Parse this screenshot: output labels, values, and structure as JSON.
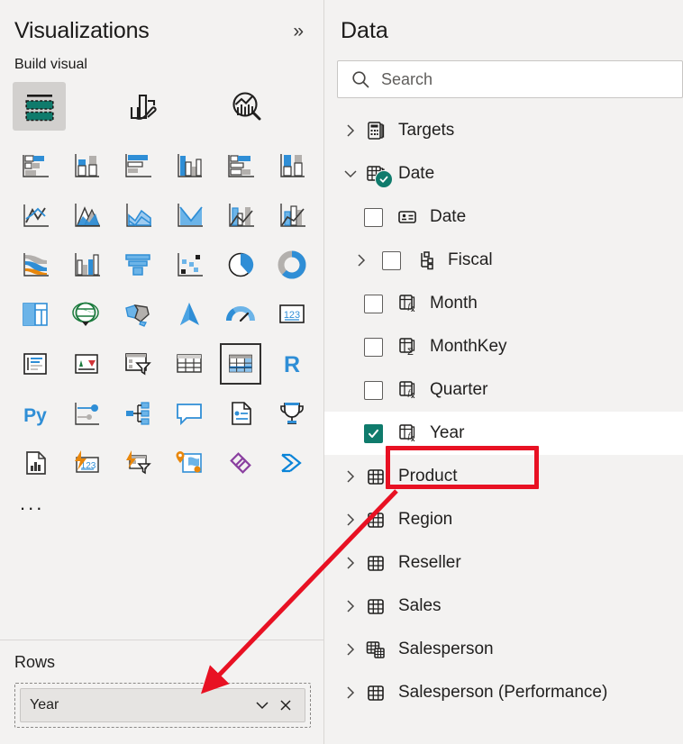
{
  "visualizations": {
    "title": "Visualizations",
    "collapse_icon": "double-chevron-right-icon",
    "build_visual_label": "Build visual",
    "tabs": [
      {
        "label": "Build visual",
        "icon": "build-visual-icon",
        "selected": true
      },
      {
        "label": "Format visual",
        "icon": "paintbrush-icon",
        "selected": false
      },
      {
        "label": "Analytics",
        "icon": "analytics-magnifier-icon",
        "selected": false
      }
    ],
    "gallery": [
      {
        "name": "stacked-bar-chart",
        "selected": false
      },
      {
        "name": "stacked-column-chart",
        "selected": false
      },
      {
        "name": "clustered-bar-chart",
        "selected": false
      },
      {
        "name": "clustered-column-chart",
        "selected": false
      },
      {
        "name": "100-stacked-bar-chart",
        "selected": false
      },
      {
        "name": "100-stacked-column-chart",
        "selected": false
      },
      {
        "name": "line-chart",
        "selected": false
      },
      {
        "name": "area-chart",
        "selected": false
      },
      {
        "name": "stacked-area-chart",
        "selected": false
      },
      {
        "name": "line-and-stacked-column-chart",
        "selected": false
      },
      {
        "name": "line-and-clustered-column-chart",
        "selected": false
      },
      {
        "name": "ribbon-chart",
        "selected": false
      },
      {
        "name": "waterfall-chart",
        "selected": false
      },
      {
        "name": "funnel-chart",
        "selected": false
      },
      {
        "name": "scatter-chart",
        "selected": false
      },
      {
        "name": "pie-chart",
        "selected": false
      },
      {
        "name": "donut-chart",
        "selected": false
      },
      {
        "name": "treemap",
        "selected": false
      },
      {
        "name": "map",
        "selected": false
      },
      {
        "name": "filled-map",
        "selected": false
      },
      {
        "name": "azure-map",
        "selected": false
      },
      {
        "name": "gauge-chart",
        "selected": false
      },
      {
        "name": "card",
        "selected": false
      },
      {
        "name": "multi-row-card",
        "selected": false
      },
      {
        "name": "kpi",
        "selected": false
      },
      {
        "name": "slicer",
        "selected": false
      },
      {
        "name": "table",
        "selected": false
      },
      {
        "name": "matrix",
        "selected": true
      },
      {
        "name": "r-script-visual",
        "selected": false
      },
      {
        "name": "python-visual",
        "selected": false
      },
      {
        "name": "key-influencers",
        "selected": false
      },
      {
        "name": "decomposition-tree",
        "selected": false
      },
      {
        "name": "qna-visual",
        "selected": false
      },
      {
        "name": "smart-narrative",
        "selected": false
      },
      {
        "name": "metrics-scorecard",
        "selected": false
      },
      {
        "name": "paginated-report",
        "selected": false
      },
      {
        "name": "power-apps-visual",
        "selected": false
      },
      {
        "name": "power-automate-visual",
        "selected": false
      },
      {
        "name": "arcgis-map",
        "selected": false
      },
      {
        "name": "powerbi-visual-purple",
        "selected": false
      },
      {
        "name": "powerbi-visual-blue",
        "selected": false
      }
    ],
    "more_options_label": "...",
    "wells": {
      "rows": {
        "title": "Rows",
        "fields": [
          {
            "label": "Year",
            "dropdown_icon": "chevron-down-icon",
            "remove_icon": "close-icon"
          }
        ]
      }
    }
  },
  "data_pane": {
    "title": "Data",
    "search": {
      "placeholder": "Search",
      "icon": "search-icon",
      "value": ""
    },
    "tree": [
      {
        "label": "Targets",
        "icon": "measure-table-icon",
        "expanded": false,
        "level": 0,
        "has_checkbox": false,
        "badge": false
      },
      {
        "label": "Date",
        "icon": "date-table-icon",
        "expanded": true,
        "level": 0,
        "has_checkbox": false,
        "badge": true
      },
      {
        "label": "Date",
        "icon": "date-field-icon",
        "level": 1,
        "has_checkbox": true,
        "checked": false,
        "expandable": false
      },
      {
        "label": "Fiscal",
        "icon": "hierarchy-icon",
        "level": 1,
        "has_checkbox": true,
        "checked": false,
        "expandable": true
      },
      {
        "label": "Month",
        "icon": "calculated-column-icon",
        "level": 1,
        "has_checkbox": true,
        "checked": false,
        "expandable": false
      },
      {
        "label": "MonthKey",
        "icon": "summarized-column-icon",
        "level": 1,
        "has_checkbox": true,
        "checked": false,
        "expandable": false
      },
      {
        "label": "Quarter",
        "icon": "calculated-column-icon",
        "level": 1,
        "has_checkbox": true,
        "checked": false,
        "expandable": false
      },
      {
        "label": "Year",
        "icon": "calculated-column-icon",
        "level": 1,
        "has_checkbox": true,
        "checked": true,
        "expandable": false,
        "highlighted": true
      },
      {
        "label": "Product",
        "icon": "table-icon",
        "expanded": false,
        "level": 0,
        "has_checkbox": false,
        "badge": false
      },
      {
        "label": "Region",
        "icon": "table-icon",
        "expanded": false,
        "level": 0,
        "has_checkbox": false,
        "badge": false
      },
      {
        "label": "Reseller",
        "icon": "table-icon",
        "expanded": false,
        "level": 0,
        "has_checkbox": false,
        "badge": false
      },
      {
        "label": "Sales",
        "icon": "table-icon",
        "expanded": false,
        "level": 0,
        "has_checkbox": false,
        "badge": false
      },
      {
        "label": "Salesperson",
        "icon": "related-table-icon",
        "expanded": false,
        "level": 0,
        "has_checkbox": false,
        "badge": false
      },
      {
        "label": "Salesperson (Performance)",
        "icon": "table-icon",
        "expanded": false,
        "level": 0,
        "has_checkbox": false,
        "badge": false
      }
    ]
  },
  "annotation": {
    "color": "#e81123",
    "highlight_target": "Year",
    "arrow_from": "Year",
    "arrow_to": "Rows well Year field"
  },
  "colors": {
    "accent_green": "#0f7b6c",
    "accent_blue": "#2f8ed6",
    "annotation_red": "#e81123",
    "pane_bg": "#f3f2f1"
  }
}
